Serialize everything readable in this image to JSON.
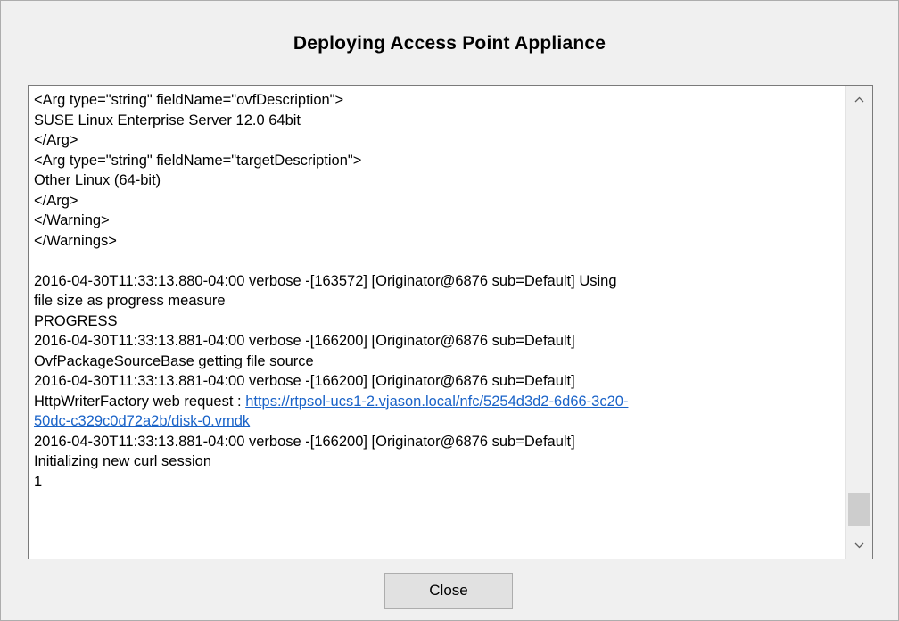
{
  "dialog": {
    "title": "Deploying Access Point Appliance",
    "close_label": "Close"
  },
  "log": {
    "lines": [
      {
        "text": "<Arg type=\"string\" fieldName=\"ovfDescription\">"
      },
      {
        "text": "SUSE Linux Enterprise Server 12.0 64bit"
      },
      {
        "text": "</Arg>"
      },
      {
        "text": "<Arg type=\"string\" fieldName=\"targetDescription\">"
      },
      {
        "text": "Other Linux (64-bit)"
      },
      {
        "text": "</Arg>"
      },
      {
        "text": "</Warning>"
      },
      {
        "text": "</Warnings>"
      },
      {
        "text": ""
      },
      {
        "text": "2016-04-30T11:33:13.880-04:00 verbose -[163572] [Originator@6876 sub=Default] Using"
      },
      {
        "text": "file size as progress measure"
      },
      {
        "text": "PROGRESS"
      },
      {
        "text": "2016-04-30T11:33:13.881-04:00 verbose -[166200] [Originator@6876 sub=Default]"
      },
      {
        "text": "OvfPackageSourceBase getting file source"
      },
      {
        "text": "2016-04-30T11:33:13.881-04:00 verbose -[166200] [Originator@6876 sub=Default]"
      },
      {
        "text": "HttpWriterFactory web request : ",
        "link": "https://rtpsol-ucs1-2.vjason.local/nfc/5254d3d2-6d66-3c20-"
      },
      {
        "text": "",
        "link": "50dc-c329c0d72a2b/disk-0.vmdk"
      },
      {
        "text": "2016-04-30T11:33:13.881-04:00 verbose -[166200] [Originator@6876 sub=Default]"
      },
      {
        "text": "Initializing new curl session"
      },
      {
        "text": "1"
      }
    ]
  },
  "scrollbar": {
    "up_icon": "chevron-up-icon",
    "down_icon": "chevron-down-icon"
  }
}
